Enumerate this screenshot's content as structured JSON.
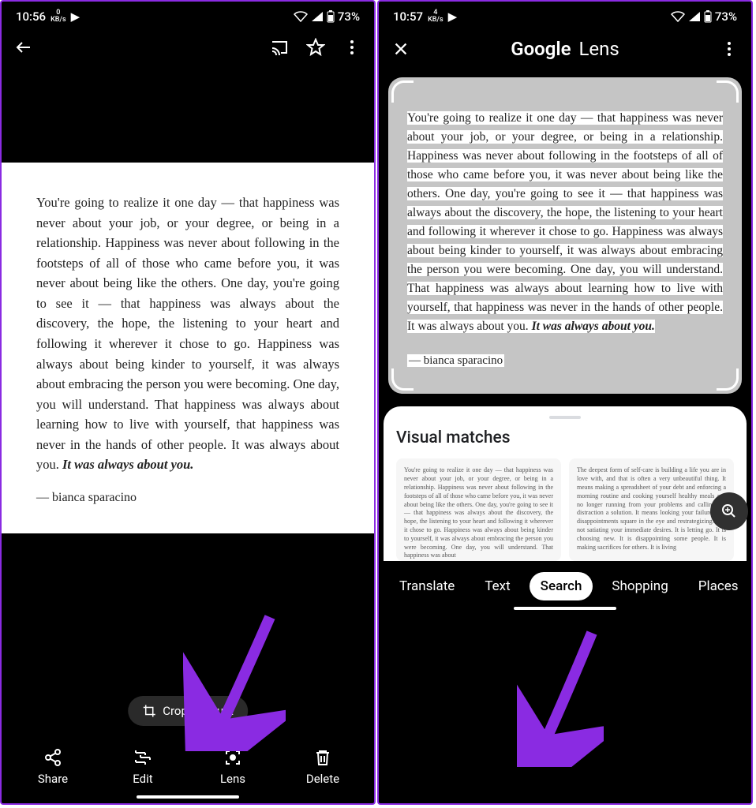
{
  "left": {
    "status": {
      "time": "10:56",
      "net_value": "0",
      "net_unit": "KB/s",
      "battery": "73%"
    },
    "quote": "You're going to realize it one day — that happiness was never about your job, or your degree, or being in a relationship. Happiness was never about following in the footsteps of all of those who came before you, it was never about being like the others. One day, you're going to see it — that happiness was always about the discovery, the hope, the listening to your heart and following it wherever it chose to go. Happiness was always about being kinder to yourself, it was always about embracing the person you were becoming. One day, you will understand. That happiness was always about learning how to live with yourself, that happiness was never in the hands of other people. It was always about you. ",
    "quote_em": "It was always about you.",
    "author": "— bianca sparacino",
    "crop_label": "Crop & adjust",
    "actions": {
      "share": "Share",
      "edit": "Edit",
      "lens": "Lens",
      "delete": "Delete"
    }
  },
  "right": {
    "status": {
      "time": "10:57",
      "net_value": "4",
      "net_unit": "KB/s",
      "battery": "73%"
    },
    "title_a": "Google",
    "title_b": "Lens",
    "quote": "You're going to realize it one day — that happiness was never about your job, or your degree, or being in a relationship. Happiness was never about following in the footsteps of all of those who came before you, it was never about being like the others. One day, you're going to see it — that happiness was always about the discovery, the hope, the listening to your heart and following it wherever it chose to go. Happiness was always about being kinder to yourself, it was always about embracing the person you were becoming. One day, you will understand. That happiness was always about learning how to live with yourself, that happiness was never in the hands of other people. It was always about you. ",
    "quote_em": "It was always about you.",
    "author": "— bianca sparacino",
    "sheet_title": "Visual matches",
    "card1": "You're going to realize it one day — that happiness was never about your job, or your degree, or being in a relationship. Happiness was never about following in the footsteps of all of those who came before you, it was never about being like the others. One day, you're going to see it — that happiness was always about the discovery, the hope, the listening to your heart and following it wherever it chose to go. Happiness was always about being kinder to yourself, it was always about embracing the person you were becoming. One day, you will understand. That happiness was about",
    "card2": "The deepest form of self-care is building a life you are in love with, and that is often a very unbeautiful thing. It means making a spreadsheet of your debt and enforcing a morning routine and cooking yourself healthy meals and no longer running from your problems and calling the distraction a solution. It means looking your failures and disappointments square in the eye and restrategizing. It is not satiating your immediate desires. It is letting go. It is choosing new. It is disappointing some people. It is making sacrifices for others. It is living",
    "tabs": {
      "translate": "Translate",
      "text": "Text",
      "search": "Search",
      "shopping": "Shopping",
      "places": "Places"
    }
  }
}
